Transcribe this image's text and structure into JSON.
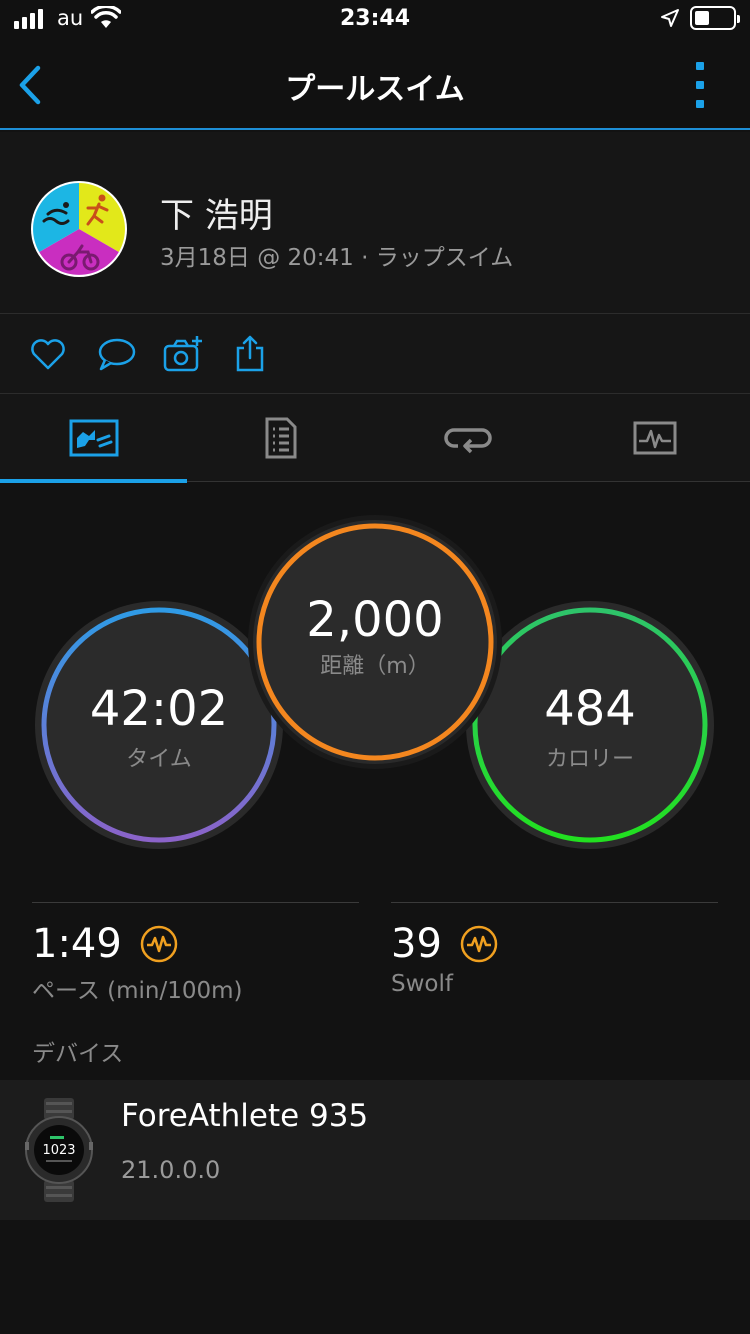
{
  "status_bar": {
    "carrier": "au",
    "time": "23:44"
  },
  "nav": {
    "title": "プールスイム"
  },
  "profile": {
    "name": "下 浩明",
    "meta": "3月18日 @ 20:41 · ラップスイム"
  },
  "tabs": [
    {
      "icon": "overview-chart-icon",
      "active": true
    },
    {
      "icon": "details-list-icon",
      "active": false
    },
    {
      "icon": "laps-loop-icon",
      "active": false
    },
    {
      "icon": "graph-waveform-icon",
      "active": false
    }
  ],
  "metrics": {
    "time": {
      "value": "42:02",
      "label": "タイム"
    },
    "distance": {
      "value": "2,000",
      "label": "距離（m）"
    },
    "calories": {
      "value": "484",
      "label": "カロリー"
    }
  },
  "stats": {
    "pace": {
      "value": "1:49",
      "label": "ペース (min/100m)"
    },
    "swolf": {
      "value": "39",
      "label": "Swolf"
    }
  },
  "devices": {
    "section_label": "デバイス",
    "name": "ForeAthlete 935",
    "version": "21.0.0.0",
    "watch_time": "1023"
  },
  "colors": {
    "accent": "#1ba1e8",
    "distance_ring": "#f4871f",
    "calories_ring": "#22d34a",
    "time_ring_top": "#2f9be6",
    "time_ring_bottom": "#8b63c9",
    "stat_icon": "#f0a020"
  }
}
